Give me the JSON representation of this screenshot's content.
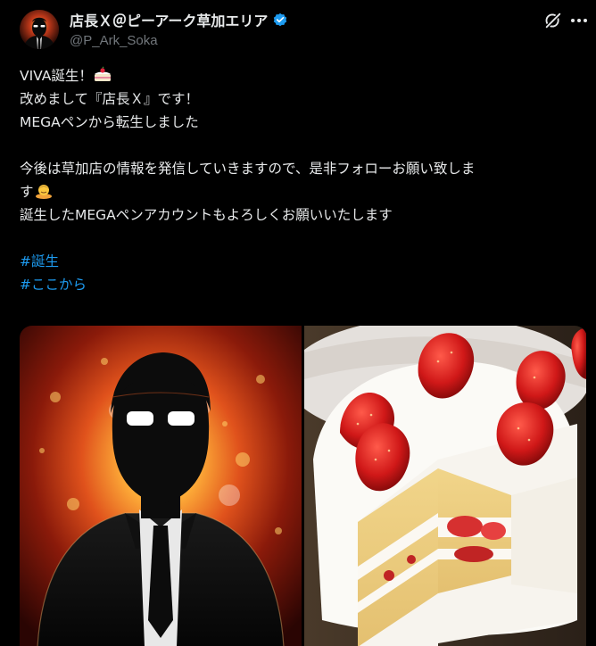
{
  "author": {
    "display_name": "店長Ｘ＠ピーアーク草加エリア",
    "handle": "@P_Ark_Soka",
    "verified_icon": "verified-badge-icon",
    "avatar_icon": "silhouette-avatar"
  },
  "header_actions": {
    "grok_icon": "grok-icon",
    "more_icon": "more-dots-icon"
  },
  "post": {
    "line1": "VIVA誕生！",
    "line2": "改めまして『店長Ｘ』です！",
    "line3": "MEGAペンから転生しました",
    "line4": "今後は草加店の情報を発信していきますので、是非フォローお願い致しま",
    "line5": "す",
    "line6": "誕生したMEGAペンアカウントもよろしくお願いいたします",
    "hashtag1": "#誕生",
    "hashtag2": "#ここから"
  },
  "emoji": {
    "cake": "cake-emoji",
    "bow": "bowing-person-emoji"
  },
  "media": {
    "image1": "shadow-silhouette-man-in-suit-with-fire-background",
    "image2": "strawberry-shortcake-slice"
  },
  "colors": {
    "background": "#000000",
    "text": "#e7e9ea",
    "secondary_text": "#71767b",
    "link": "#1d9bf0",
    "verified": "#1d9bf0"
  }
}
